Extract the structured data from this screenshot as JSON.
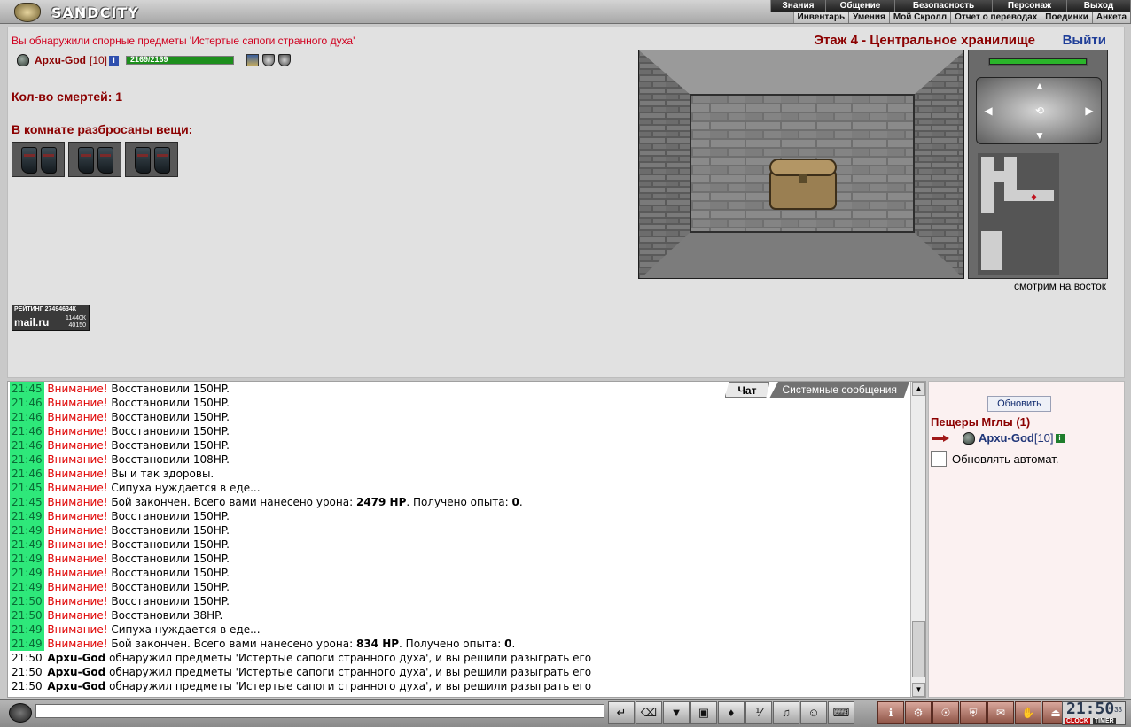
{
  "header": {
    "brand": "SANDCITY",
    "main_menu": [
      "Знания",
      "Общение",
      "Безопасность",
      "Персонаж",
      "Выход"
    ],
    "sub_menu": [
      "Инвентарь",
      "Умения",
      "Мой Скролл",
      "Отчет о переводах",
      "Поединки",
      "Анкета"
    ]
  },
  "game": {
    "event_message": "Вы обнаружили спорные предметы 'Истертые сапоги странного духа'",
    "player": {
      "name": "Apxu-God",
      "level": "[10]",
      "hp_text": "2169/2169",
      "hp_percent": 100
    },
    "deaths": "Кол-во смертей: 1",
    "items_title": "В комнате разбросаны вещи:",
    "items": [
      "boots-icon",
      "boots-icon",
      "boots-icon"
    ],
    "floor_title": "Этаж 4 - Центральное хранилище",
    "exit_link": "Выйти",
    "look_direction": "смотрим на восток",
    "rating": {
      "label": "РЕЙТИНГ 27494634К",
      "brand": "mail.ru",
      "num1": "11440К",
      "num2": "40150"
    }
  },
  "chat": {
    "tabs": [
      "Чат",
      "Системные сообщения"
    ],
    "lines": [
      {
        "time": "21:45",
        "hl": true,
        "type": "warn",
        "warn": "Внимание!",
        "text": " Восстановили 150HP."
      },
      {
        "time": "21:46",
        "hl": true,
        "type": "warn",
        "warn": "Внимание!",
        "text": " Восстановили 150HP."
      },
      {
        "time": "21:46",
        "hl": true,
        "type": "warn",
        "warn": "Внимание!",
        "text": " Восстановили 150HP."
      },
      {
        "time": "21:46",
        "hl": true,
        "type": "warn",
        "warn": "Внимание!",
        "text": " Восстановили 150HP."
      },
      {
        "time": "21:46",
        "hl": true,
        "type": "warn",
        "warn": "Внимание!",
        "text": " Восстановили 150HP."
      },
      {
        "time": "21:46",
        "hl": true,
        "type": "warn",
        "warn": "Внимание!",
        "text": " Восстановили 108HP."
      },
      {
        "time": "21:46",
        "hl": true,
        "type": "warn",
        "warn": "Внимание!",
        "text": " Вы и так здоровы."
      },
      {
        "time": "21:45",
        "hl": true,
        "type": "warn",
        "warn": "Внимание!",
        "text": " Сипуха нуждается в еде..."
      },
      {
        "time": "21:45",
        "hl": true,
        "type": "battle",
        "warn": "Внимание!",
        "text": " Бой закончен. Всего вами нанесено урона: ",
        "b1": "2479 HP",
        "mid": ". Получено опыта: ",
        "b2": "0",
        "end": "."
      },
      {
        "time": "21:49",
        "hl": true,
        "type": "warn",
        "warn": "Внимание!",
        "text": " Восстановили 150HP."
      },
      {
        "time": "21:49",
        "hl": true,
        "type": "warn",
        "warn": "Внимание!",
        "text": " Восстановили 150HP."
      },
      {
        "time": "21:49",
        "hl": true,
        "type": "warn",
        "warn": "Внимание!",
        "text": " Восстановили 150HP."
      },
      {
        "time": "21:49",
        "hl": true,
        "type": "warn",
        "warn": "Внимание!",
        "text": " Восстановили 150HP."
      },
      {
        "time": "21:49",
        "hl": true,
        "type": "warn",
        "warn": "Внимание!",
        "text": " Восстановили 150HP."
      },
      {
        "time": "21:49",
        "hl": true,
        "type": "warn",
        "warn": "Внимание!",
        "text": " Восстановили 150HP."
      },
      {
        "time": "21:50",
        "hl": true,
        "type": "warn",
        "warn": "Внимание!",
        "text": " Восстановили 150HP."
      },
      {
        "time": "21:50",
        "hl": true,
        "type": "warn",
        "warn": "Внимание!",
        "text": " Восстановили 38HP."
      },
      {
        "time": "21:49",
        "hl": true,
        "type": "warn",
        "warn": "Внимание!",
        "text": " Сипуха нуждается в еде..."
      },
      {
        "time": "21:49",
        "hl": true,
        "type": "battle",
        "warn": "Внимание!",
        "text": " Бой закончен. Всего вами нанесено урона: ",
        "b1": "834 HP",
        "mid": ". Получено опыта: ",
        "b2": "0",
        "end": "."
      },
      {
        "time": "21:50",
        "hl": false,
        "type": "found",
        "nick": "Apxu-God",
        "text": " обнаружил предметы 'Истертые сапоги странного духа', и вы решили разыграть его"
      },
      {
        "time": "21:50",
        "hl": false,
        "type": "found",
        "nick": "Apxu-God",
        "text": " обнаружил предметы 'Истертые сапоги странного духа', и вы решили разыграть его"
      },
      {
        "time": "21:50",
        "hl": false,
        "type": "found",
        "nick": "Apxu-God",
        "text": " обнаружил предметы 'Истертые сапоги странного духа', и вы решили разыграть его"
      }
    ]
  },
  "right_panel": {
    "refresh_label": "Обновить",
    "location": "Пещеры Мглы (1)",
    "online_user": {
      "name": "Apxu-God",
      "level": "[10]"
    },
    "auto_refresh_label": "Обновлять автомат."
  },
  "bottom": {
    "input_value": "",
    "tool_icons": [
      "send-icon",
      "clear-icon",
      "filter-icon",
      "save-icon",
      "smile-dance-icon",
      "translit-icon",
      "music-icon",
      "smiley-icon",
      "keyboard-icon"
    ],
    "tool_glyphs": [
      "↵",
      "⌫",
      "▼",
      "▣",
      "♦",
      "⅟",
      "♫",
      "☺",
      "⌨"
    ],
    "action_icons": [
      "info-action-icon",
      "scroll-action-icon",
      "rune-action-icon",
      "shield-action-icon",
      "gift-action-icon",
      "hand-action-icon",
      "exit-action-icon"
    ],
    "action_glyphs": [
      "ℹ",
      "⚙",
      "☉",
      "⛨",
      "✉",
      "✋",
      "⏏"
    ],
    "clock_time": "21:50",
    "clock_sec": "33",
    "clock_label": "CLOCK",
    "timer_label": "TIMER"
  },
  "colors": {
    "accent_red": "#8b0000",
    "alert_red": "#e00000",
    "time_highlight": "#2ee87a",
    "link_blue": "#1f3e98"
  }
}
